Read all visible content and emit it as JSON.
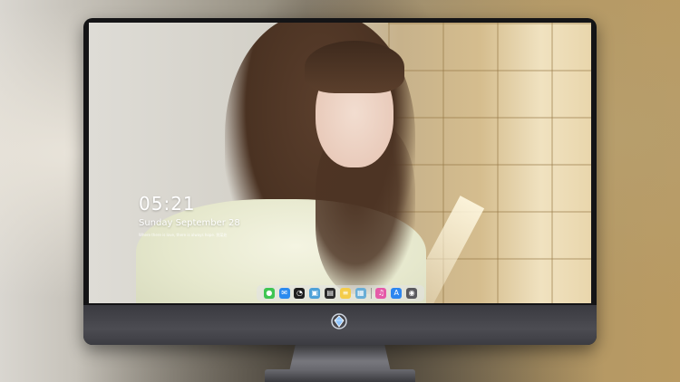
{
  "lock_screen": {
    "time": "05:21",
    "date": "Sunday September  28",
    "quote": "Where there is love, there is always hope. 到某处"
  },
  "dock": {
    "items": [
      {
        "name": "messages-icon",
        "glyph": "●",
        "color": "#3fc552"
      },
      {
        "name": "mail-icon",
        "glyph": "✉",
        "color": "#2b8bef"
      },
      {
        "name": "clock-icon",
        "glyph": "◔",
        "color": "#1f1f1f"
      },
      {
        "name": "preview-icon",
        "glyph": "▣",
        "color": "#4ea1d8"
      },
      {
        "name": "clapper-icon",
        "glyph": "▤",
        "color": "#2a2a2a"
      },
      {
        "name": "notes-icon",
        "glyph": "≡",
        "color": "#f4cc4a"
      },
      {
        "name": "photos-icon",
        "glyph": "▦",
        "color": "#6aaed6"
      },
      {
        "name": "music-icon",
        "glyph": "♫",
        "color": "#e55aa8"
      },
      {
        "name": "app-store-icon",
        "glyph": "A",
        "color": "#2c86f0"
      },
      {
        "name": "camera-icon",
        "glyph": "◉",
        "color": "#5a5a5e"
      }
    ]
  },
  "colors": {
    "bezel": "#141416",
    "chin": "#4c4c52",
    "dock_background": "rgba(225,225,228,0.55)",
    "clock_text": "#ffffff"
  }
}
